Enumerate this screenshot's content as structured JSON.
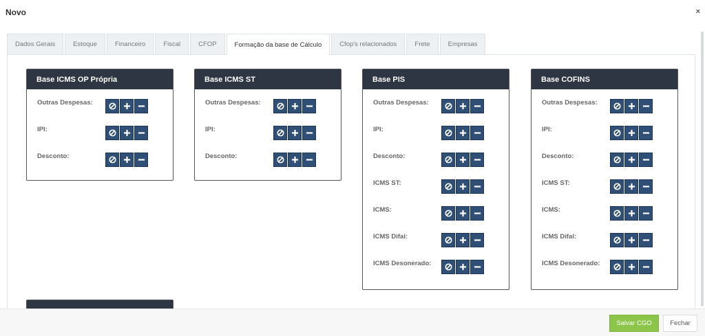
{
  "modal": {
    "title": "Novo",
    "close_symbol": "×"
  },
  "tabs": [
    {
      "label": "Dados Gerais",
      "active": false
    },
    {
      "label": "Estoque",
      "active": false
    },
    {
      "label": "Financeiro",
      "active": false
    },
    {
      "label": "Fiscal",
      "active": false
    },
    {
      "label": "CFOP",
      "active": false
    },
    {
      "label": "Formação da base de Cálculo",
      "active": true
    },
    {
      "label": "Cfop's relacionados",
      "active": false
    },
    {
      "label": "Frete",
      "active": false
    },
    {
      "label": "Empresas",
      "active": false
    }
  ],
  "cards": [
    {
      "title": "Base ICMS OP Própria",
      "rows": [
        "Outras Despesas:",
        "IPI:",
        "Desconto:"
      ]
    },
    {
      "title": "Base ICMS ST",
      "rows": [
        "Outras Despesas:",
        "IPI:",
        "Desconto:"
      ]
    },
    {
      "title": "Base PIS",
      "rows": [
        "Outras Despesas:",
        "IPI:",
        "Desconto:",
        "ICMS ST:",
        "ICMS:",
        "ICMS Difal:",
        "ICMS Desonerado:"
      ]
    },
    {
      "title": "Base COFINS",
      "rows": [
        "Outras Despesas:",
        "IPI:",
        "Desconto:",
        "ICMS ST:",
        "ICMS:",
        "ICMS Difal:",
        "ICMS Desonerado:"
      ]
    },
    {
      "title": "",
      "rows": []
    }
  ],
  "row_controls": [
    "ban-icon",
    "plus-icon",
    "minus-icon"
  ],
  "footer": {
    "save_label": "Salvar CGO",
    "close_label": "Fechar"
  },
  "colors": {
    "card_header": "#2f3643",
    "control_button": "#2f4f76",
    "save_button": "#8dc54a"
  }
}
